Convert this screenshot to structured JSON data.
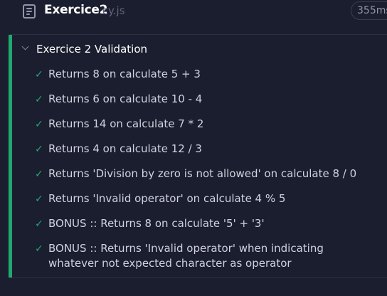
{
  "spec": {
    "name": "Exercice2",
    "extension": ".cy.js",
    "duration": "355ms"
  },
  "suite": {
    "title": "Exercice 2 Validation",
    "tests": [
      {
        "title": "Returns 8 on calculate 5 + 3",
        "status": "passed"
      },
      {
        "title": "Returns 6 on calculate 10 - 4",
        "status": "passed"
      },
      {
        "title": "Returns 14 on calculate 7 * 2",
        "status": "passed"
      },
      {
        "title": "Returns 4 on calculate 12 / 3",
        "status": "passed"
      },
      {
        "title": "Returns 'Division by zero is not allowed' on calculate 8 / 0",
        "status": "passed"
      },
      {
        "title": "Returns 'Invalid operator' on calculate 4 % 5",
        "status": "passed"
      },
      {
        "title": "BONUS :: Returns 8 on calculate '5' + '3'",
        "status": "passed"
      },
      {
        "title": "BONUS :: Returns 'Invalid operator' when indicating whatever not expected character as operator",
        "status": "passed"
      }
    ]
  },
  "colors": {
    "background": "#1b1e2e",
    "passed": "#1fa971",
    "text": "#d0d2e0"
  }
}
